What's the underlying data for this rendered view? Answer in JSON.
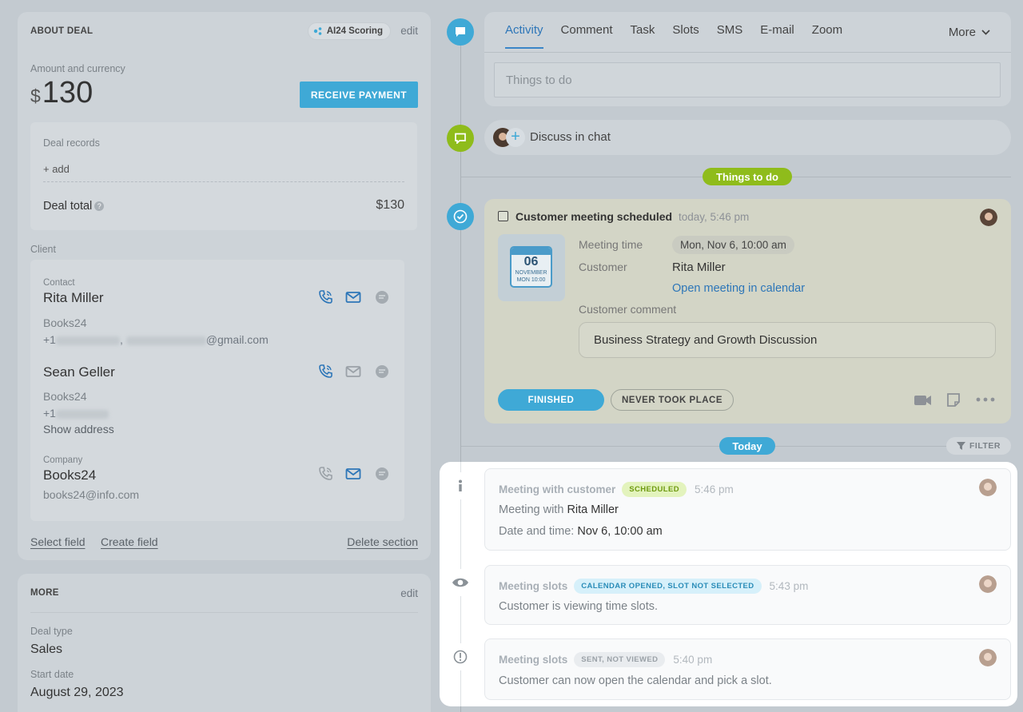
{
  "about": {
    "title": "ABOUT DEAL",
    "ai_badge": "AI24 Scoring",
    "edit": "edit",
    "amount_label": "Amount and currency",
    "currency_symbol": "$",
    "amount": "130",
    "receive_payment": "RECEIVE PAYMENT",
    "deal_records": "Deal records",
    "add": "+ add",
    "deal_total_label": "Deal total",
    "deal_total_value": "$130",
    "client_label": "Client",
    "contact_label": "Contact",
    "contacts": [
      {
        "name": "Rita Miller",
        "company": "Books24",
        "phone_prefix": "+1",
        "email_suffix": "@gmail.com"
      },
      {
        "name": "Sean Geller",
        "company": "Books24",
        "phone_prefix": "+1",
        "show_address": "Show address"
      }
    ],
    "company_label": "Company",
    "company_name": "Books24",
    "company_email": "books24@info.com",
    "select_field": "Select field",
    "create_field": "Create field",
    "delete_section": "Delete section"
  },
  "more": {
    "title": "MORE",
    "edit": "edit",
    "deal_type_label": "Deal type",
    "deal_type": "Sales",
    "start_date_label": "Start date",
    "start_date": "August 29, 2023"
  },
  "tabs": [
    "Activity",
    "Comment",
    "Task",
    "Slots",
    "SMS",
    "E-mail",
    "Zoom"
  ],
  "tabs_more": "More",
  "things_placeholder": "Things to do",
  "discuss_chat": "Discuss in chat",
  "things_pill": "Things to do",
  "meeting": {
    "title": "Customer meeting scheduled",
    "time": "today, 5:46 pm",
    "cal_day": "06",
    "cal_month": "NOVEMBER",
    "cal_time": "MON 10:00",
    "meeting_time_label": "Meeting time",
    "meeting_time": "Mon, Nov 6, 10:00 am",
    "customer_label": "Customer",
    "customer": "Rita Miller",
    "open_calendar": "Open meeting in calendar",
    "comment_label": "Customer comment",
    "comment": "Business Strategy and Growth Discussion",
    "finished": "FINISHED",
    "never_took_place": "NEVER TOOK PLACE"
  },
  "today_pill": "Today",
  "filter": "FILTER",
  "events": [
    {
      "title": "Meeting with customer",
      "tag": "SCHEDULED",
      "time": "5:46 pm",
      "line1_prefix": "Meeting with",
      "line1_value": "Rita Miller",
      "line2_prefix": "Date and time:",
      "line2_value": "Nov 6, 10:00 am"
    },
    {
      "title": "Meeting slots",
      "tag": "CALENDAR OPENED, SLOT NOT SELECTED",
      "time": "5:43 pm",
      "text": "Customer is viewing time slots."
    },
    {
      "title": "Meeting slots",
      "tag": "SENT, NOT VIEWED",
      "time": "5:40 pm",
      "text": "Customer can now open the calendar and pick a slot."
    }
  ],
  "colors": {
    "accent_blue": "#3fa9d6",
    "green": "#8fbc1b",
    "tag_green_bg": "#e3f3bd",
    "tag_blue_bg": "#d6f0fa"
  }
}
